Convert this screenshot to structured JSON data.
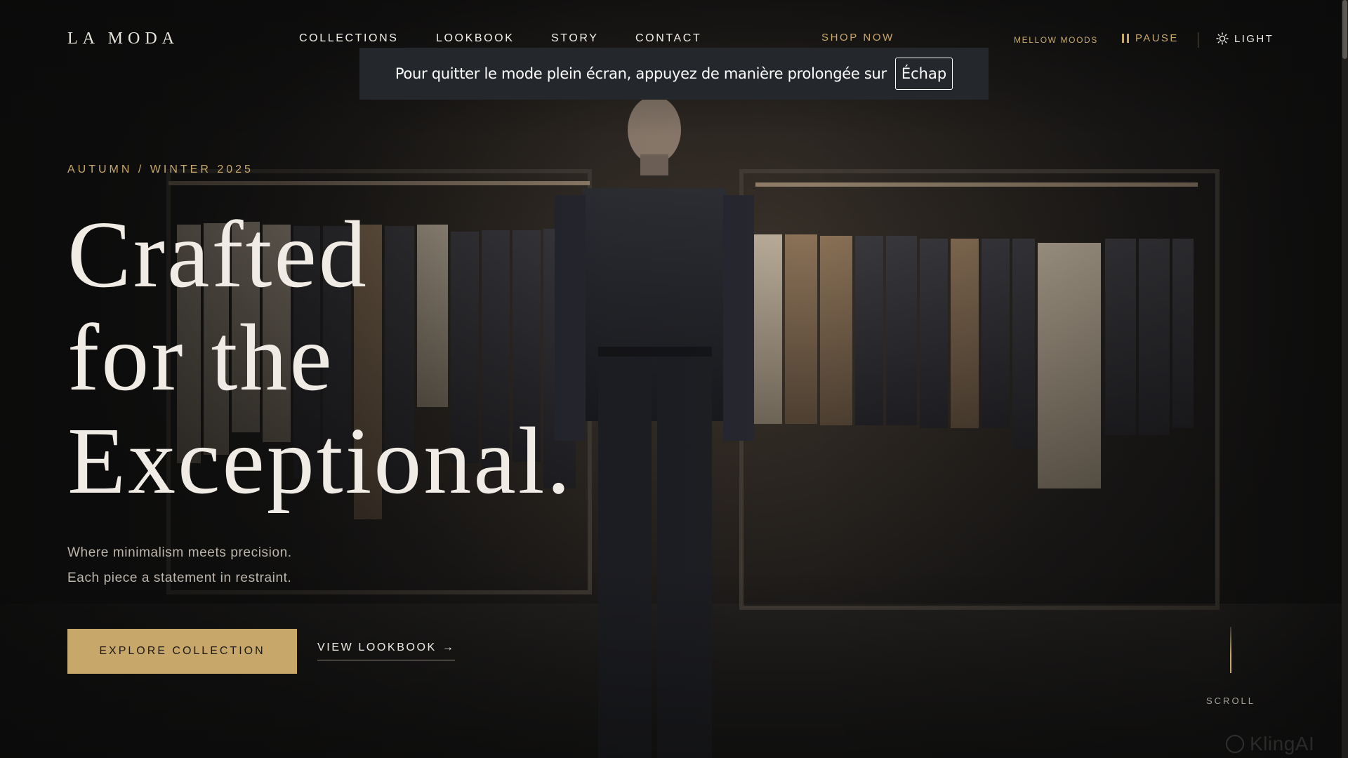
{
  "brand": {
    "logo": "LA MODA"
  },
  "nav": {
    "items": [
      {
        "label": "COLLECTIONS"
      },
      {
        "label": "LOOKBOOK"
      },
      {
        "label": "STORY"
      },
      {
        "label": "CONTACT"
      }
    ],
    "shop_now": "SHOP NOW"
  },
  "controls": {
    "mood": "MELLOW MOODS",
    "pause_label": "PAUSE",
    "theme_label": "LIGHT"
  },
  "fullscreen_notice": {
    "message": "Pour quitter le mode plein écran, appuyez de manière prolongée sur",
    "key": "Échap"
  },
  "hero": {
    "eyebrow": "AUTUMN / WINTER 2025",
    "headline": [
      "Crafted",
      "for the",
      "Exceptional."
    ],
    "subline": [
      "Where minimalism meets precision.",
      "Each piece a statement in restraint."
    ],
    "primary_cta": "EXPLORE COLLECTION",
    "secondary_cta": "VIEW LOOKBOOK",
    "secondary_cta_arrow": "→"
  },
  "scroll": {
    "label": "SCROLL"
  },
  "watermark": "KlingAI",
  "colors": {
    "accent": "#c8a86a",
    "background": "#1b1a19",
    "text": "#f0ece5",
    "notice_bg": "#24272b"
  }
}
